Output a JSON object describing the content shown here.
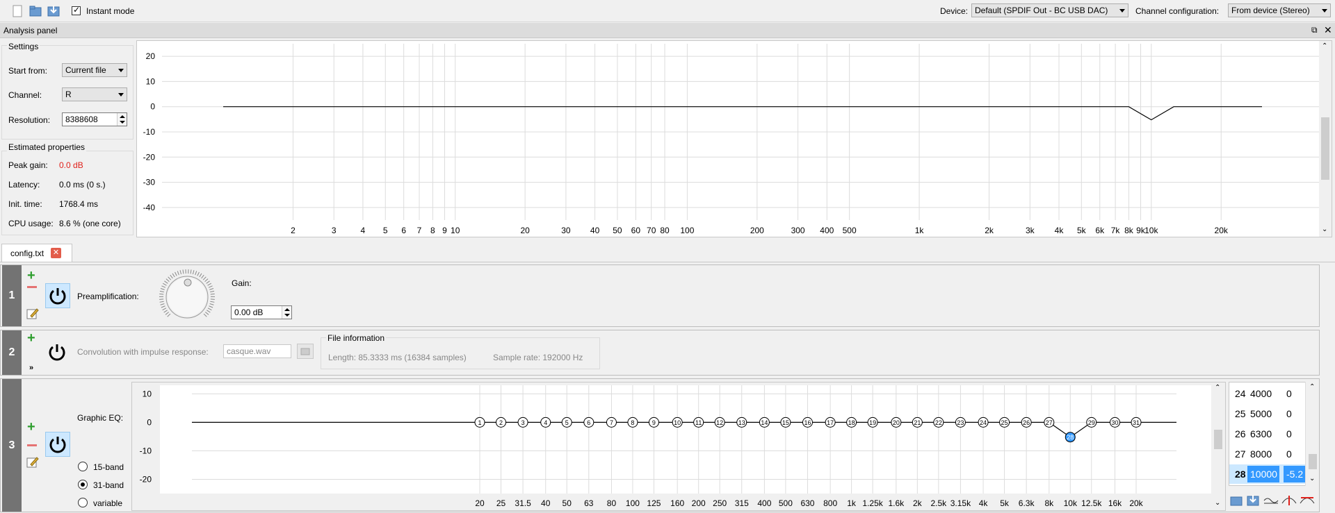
{
  "toolbar": {
    "instant_mode_label": "Instant mode",
    "instant_mode_checked": true,
    "device_label": "Device:",
    "device_value": "Default (SPDIF Out - BC USB DAC)",
    "channel_config_label": "Channel configuration:",
    "channel_config_value": "From device (Stereo)"
  },
  "analysis_panel": {
    "title": "Analysis panel",
    "settings_title": "Settings",
    "start_from_label": "Start from:",
    "start_from_value": "Current file",
    "channel_label": "Channel:",
    "channel_value": "R",
    "resolution_label": "Resolution:",
    "resolution_value": "8388608",
    "estimated_title": "Estimated properties",
    "peak_gain_label": "Peak gain:",
    "peak_gain_value": "0.0 dB",
    "latency_label": "Latency:",
    "latency_value": "0.0 ms (0 s.)",
    "init_time_label": "Init. time:",
    "init_time_value": "1768.4 ms",
    "cpu_label": "CPU usage:",
    "cpu_value": "8.6 % (one core)"
  },
  "analysis_chart": {
    "y_ticks": [
      20,
      10,
      0,
      -10,
      -20,
      -30,
      -40
    ],
    "ylim": [
      -45,
      25
    ],
    "x_ticks": [
      {
        "f": 2,
        "label": "2"
      },
      {
        "f": 3,
        "label": "3"
      },
      {
        "f": 4,
        "label": "4"
      },
      {
        "f": 5,
        "label": "5"
      },
      {
        "f": 6,
        "label": "6"
      },
      {
        "f": 7,
        "label": "7"
      },
      {
        "f": 8,
        "label": "8"
      },
      {
        "f": 9,
        "label": "9"
      },
      {
        "f": 10,
        "label": "10"
      },
      {
        "f": 20,
        "label": "20"
      },
      {
        "f": 30,
        "label": "30"
      },
      {
        "f": 40,
        "label": "40"
      },
      {
        "f": 50,
        "label": "50"
      },
      {
        "f": 60,
        "label": "60"
      },
      {
        "f": 70,
        "label": "70"
      },
      {
        "f": 80,
        "label": "80"
      },
      {
        "f": 100,
        "label": "100"
      },
      {
        "f": 200,
        "label": "200"
      },
      {
        "f": 300,
        "label": "300"
      },
      {
        "f": 400,
        "label": "400"
      },
      {
        "f": 500,
        "label": "500"
      },
      {
        "f": 1000,
        "label": "1k"
      },
      {
        "f": 2000,
        "label": "2k"
      },
      {
        "f": 3000,
        "label": "3k"
      },
      {
        "f": 4000,
        "label": "4k"
      },
      {
        "f": 5000,
        "label": "5k"
      },
      {
        "f": 6000,
        "label": "6k"
      },
      {
        "f": 7000,
        "label": "7k"
      },
      {
        "f": 8000,
        "label": "8k"
      },
      {
        "f": 9000,
        "label": "9k"
      },
      {
        "f": 10000,
        "label": "10k"
      },
      {
        "f": 20000,
        "label": "20k"
      }
    ],
    "xrange": [
      1,
      30000
    ],
    "curve": [
      {
        "f": 1,
        "g": 0
      },
      {
        "f": 8000,
        "g": 0
      },
      {
        "f": 10000,
        "g": -5.2
      },
      {
        "f": 12500,
        "g": 0
      },
      {
        "f": 30000,
        "g": 0
      }
    ]
  },
  "tabs": [
    {
      "label": "config.txt"
    }
  ],
  "filters": {
    "row1": {
      "number": "1",
      "label": "Preamplification:",
      "gain_label": "Gain:",
      "gain_value": "0.00 dB"
    },
    "row2": {
      "number": "2",
      "label": "Convolution with impulse response:",
      "file_value": "casque.wav",
      "file_info_title": "File information",
      "length_text": "Length:  85.3333 ms (16384 samples)",
      "sample_rate_text": "Sample rate:  192000 Hz"
    },
    "row3": {
      "number": "3",
      "label": "Graphic EQ:",
      "modes": [
        {
          "label": "15-band",
          "checked": false
        },
        {
          "label": "31-band",
          "checked": true
        },
        {
          "label": "variable",
          "checked": false
        }
      ]
    }
  },
  "eq_chart": {
    "y_ticks": [
      10,
      0,
      -10,
      -20
    ],
    "ylim": [
      -25,
      13
    ],
    "xrange": [
      4.5,
      30000
    ],
    "line_start": 3.2,
    "line_end": 27000,
    "bands": [
      {
        "n": 1,
        "f": 20,
        "label": "20",
        "g": 0
      },
      {
        "n": 2,
        "f": 25,
        "label": "25",
        "g": 0
      },
      {
        "n": 3,
        "f": 31.5,
        "label": "31.5",
        "g": 0
      },
      {
        "n": 4,
        "f": 40,
        "label": "40",
        "g": 0
      },
      {
        "n": 5,
        "f": 50,
        "label": "50",
        "g": 0
      },
      {
        "n": 6,
        "f": 63,
        "label": "63",
        "g": 0
      },
      {
        "n": 7,
        "f": 80,
        "label": "80",
        "g": 0
      },
      {
        "n": 8,
        "f": 100,
        "label": "100",
        "g": 0
      },
      {
        "n": 9,
        "f": 125,
        "label": "125",
        "g": 0
      },
      {
        "n": 10,
        "f": 160,
        "label": "160",
        "g": 0
      },
      {
        "n": 11,
        "f": 200,
        "label": "200",
        "g": 0
      },
      {
        "n": 12,
        "f": 250,
        "label": "250",
        "g": 0
      },
      {
        "n": 13,
        "f": 315,
        "label": "315",
        "g": 0
      },
      {
        "n": 14,
        "f": 400,
        "label": "400",
        "g": 0
      },
      {
        "n": 15,
        "f": 500,
        "label": "500",
        "g": 0
      },
      {
        "n": 16,
        "f": 630,
        "label": "630",
        "g": 0
      },
      {
        "n": 17,
        "f": 800,
        "label": "800",
        "g": 0
      },
      {
        "n": 18,
        "f": 1000,
        "label": "1k",
        "g": 0
      },
      {
        "n": 19,
        "f": 1250,
        "label": "1.25k",
        "g": 0
      },
      {
        "n": 20,
        "f": 1600,
        "label": "1.6k",
        "g": 0
      },
      {
        "n": 21,
        "f": 2000,
        "label": "2k",
        "g": 0
      },
      {
        "n": 22,
        "f": 2500,
        "label": "2.5k",
        "g": 0
      },
      {
        "n": 23,
        "f": 3150,
        "label": "3.15k",
        "g": 0
      },
      {
        "n": 24,
        "f": 4000,
        "label": "4k",
        "g": 0
      },
      {
        "n": 25,
        "f": 5000,
        "label": "5k",
        "g": 0
      },
      {
        "n": 26,
        "f": 6300,
        "label": "6.3k",
        "g": 0
      },
      {
        "n": 27,
        "f": 8000,
        "label": "8k",
        "g": 0
      },
      {
        "n": 28,
        "f": 10000,
        "label": "10k",
        "g": -5.2
      },
      {
        "n": 29,
        "f": 12500,
        "label": "12.5k",
        "g": 0
      },
      {
        "n": 30,
        "f": 16000,
        "label": "16k",
        "g": 0
      },
      {
        "n": 31,
        "f": 20000,
        "label": "20k",
        "g": 0
      }
    ],
    "selected_band": 28
  },
  "band_table": [
    {
      "n": "24",
      "f": "4000",
      "g": "0",
      "selected": false
    },
    {
      "n": "25",
      "f": "5000",
      "g": "0",
      "selected": false
    },
    {
      "n": "26",
      "f": "6300",
      "g": "0",
      "selected": false
    },
    {
      "n": "27",
      "f": "8000",
      "g": "0",
      "selected": false
    },
    {
      "n": "28",
      "f": "10000",
      "g": "-5.2",
      "selected": true
    }
  ],
  "colors": {
    "peak_gain": "#e0201a",
    "grid": "#dcdcdc",
    "selected_band_fill": "#3399ff",
    "add_green": "#2e9e2e",
    "remove_red": "#e57373"
  }
}
